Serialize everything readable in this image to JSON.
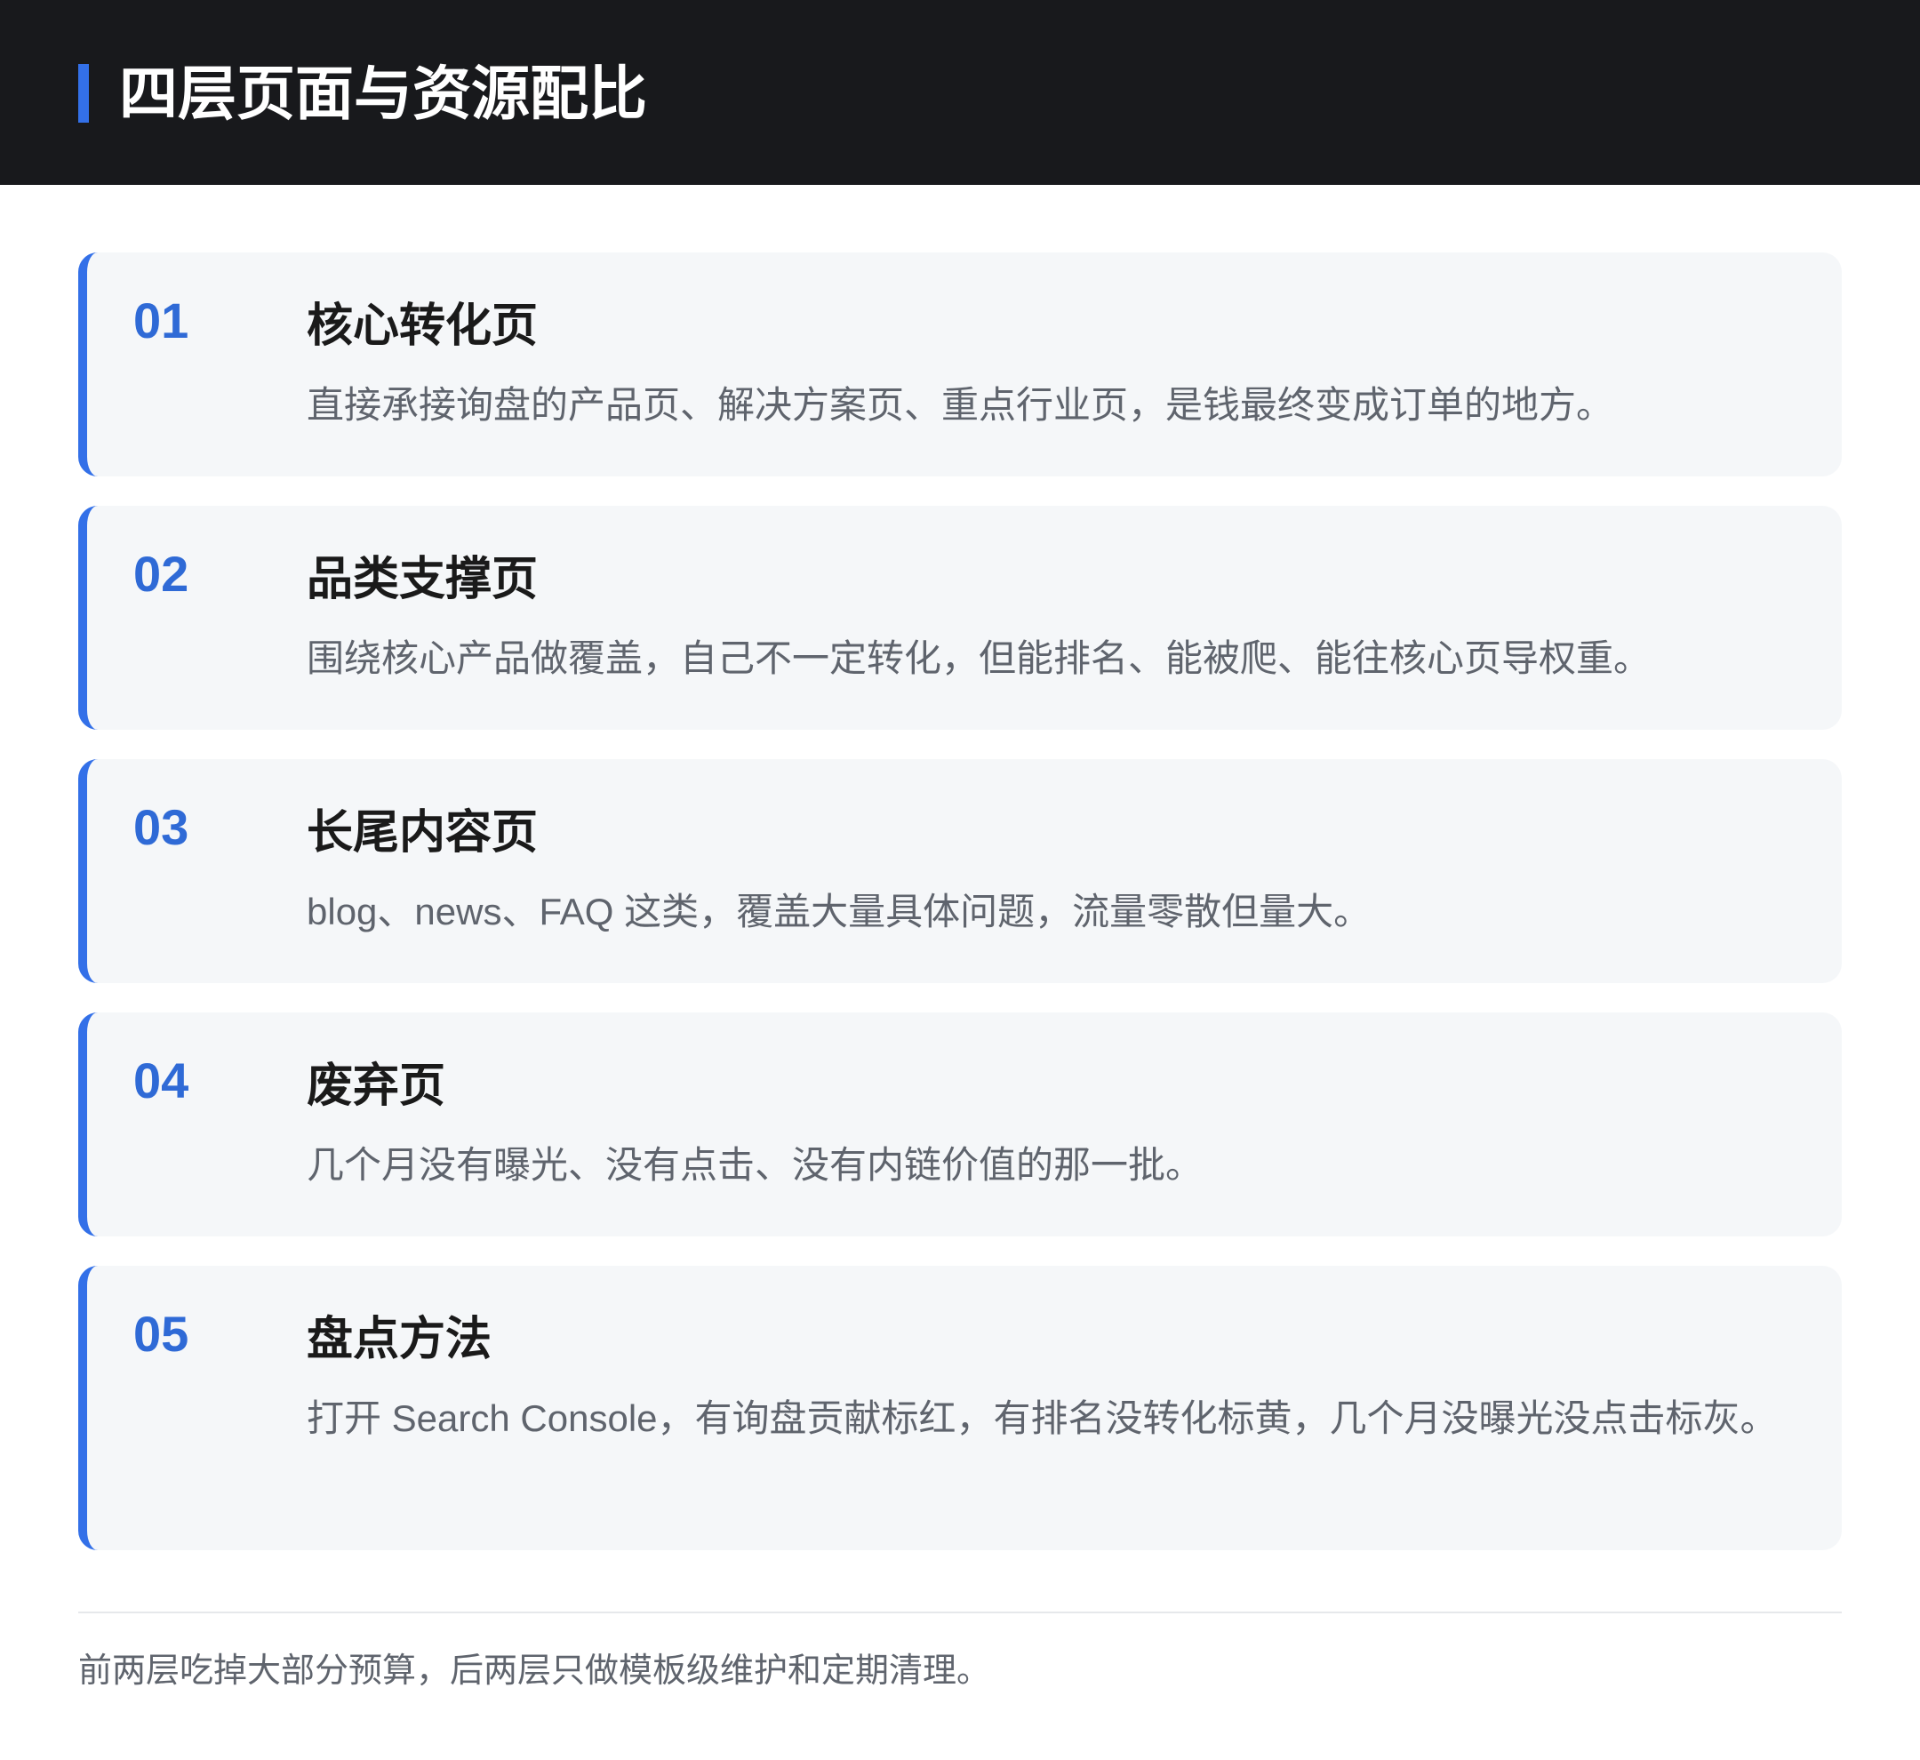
{
  "header": {
    "title": "四层页面与资源配比"
  },
  "cards": [
    {
      "num": "01",
      "title": "核心转化页",
      "desc": "直接承接询盘的产品页、解决方案页、重点行业页，是钱最终变成订单的地方。"
    },
    {
      "num": "02",
      "title": "品类支撑页",
      "desc": "围绕核心产品做覆盖，自己不一定转化，但能排名、能被爬、能往核心页导权重。"
    },
    {
      "num": "03",
      "title": "长尾内容页",
      "desc": "blog、news、FAQ 这类，覆盖大量具体问题，流量零散但量大。"
    },
    {
      "num": "04",
      "title": "废弃页",
      "desc": "几个月没有曝光、没有点击、没有内链价值的那一批。"
    },
    {
      "num": "05",
      "title": "盘点方法",
      "desc": "打开 Search Console，有询盘贡献标红，有排名没转化标黄，几个月没曝光没点击标灰。"
    }
  ],
  "footer": {
    "note": "前两层吃掉大部分预算，后两层只做模板级维护和定期清理。"
  },
  "colors": {
    "header_bg": "#18191c",
    "accent": "#3370e8",
    "card_bg": "#f5f7f9"
  }
}
